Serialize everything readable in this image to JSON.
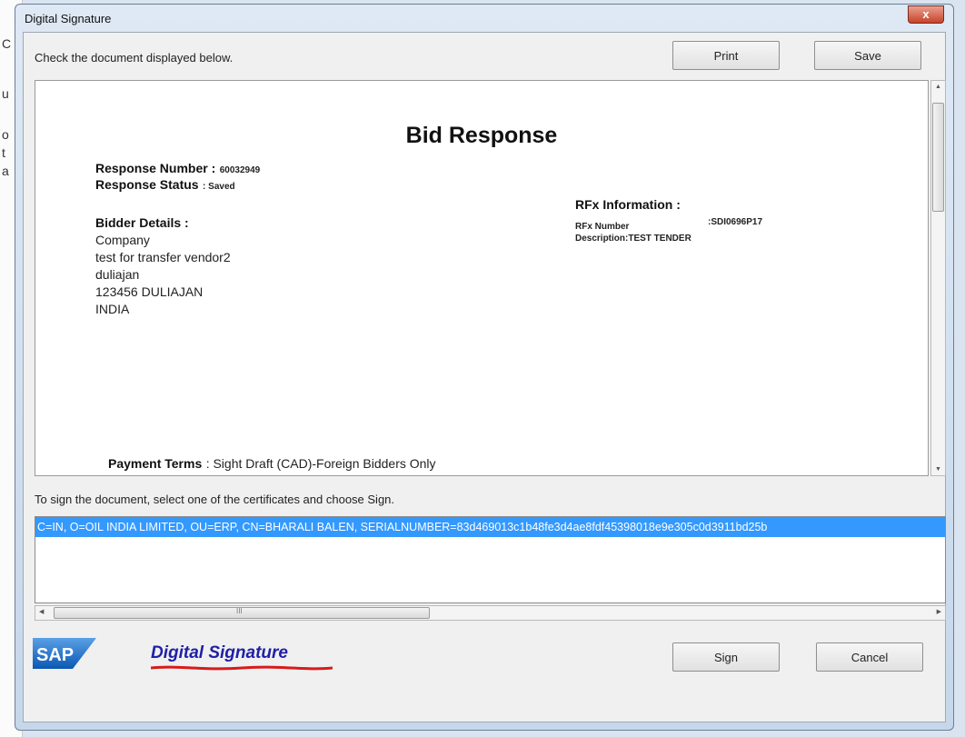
{
  "window": {
    "title": "Digital Signature",
    "close_label": "x"
  },
  "header": {
    "instruction": "Check the document displayed below.",
    "print_label": "Print",
    "save_label": "Save"
  },
  "document": {
    "title": "Bid Response",
    "response_number_label": "Response Number :",
    "response_number": "60032949",
    "response_status_label": "Response Status",
    "response_status": ": Saved",
    "bidder_details_label": "Bidder Details :",
    "bidder": [
      "Company",
      "test for transfer vendor2",
      "duliajan",
      "123456 DULIAJAN",
      "INDIA"
    ],
    "rfx_info_label": "RFx Information :",
    "rfx_number_label": "RFx Number",
    "rfx_number": ":SDI0696P17",
    "description": "Description:TEST TENDER",
    "payment_terms_label": "Payment Terms",
    "payment_terms": ":  Sight Draft (CAD)-Foreign Bidders Only"
  },
  "signing": {
    "hint": "To sign the document, select one of the certificates and choose Sign.",
    "certificates": [
      "C=IN, O=OIL INDIA LIMITED, OU=ERP, CN=BHARALI BALEN, SERIALNUMBER=83d469013c1b48fe3d4ae8fdf45398018e9e305c0d3911bd25b"
    ],
    "hscroll_grip": "III",
    "sign_label": "Sign",
    "cancel_label": "Cancel"
  },
  "branding": {
    "sap": "SAP",
    "digital_signature": "Digital Signature",
    "sap_color": "#1565c0",
    "accent_red": "#d81b1b"
  }
}
